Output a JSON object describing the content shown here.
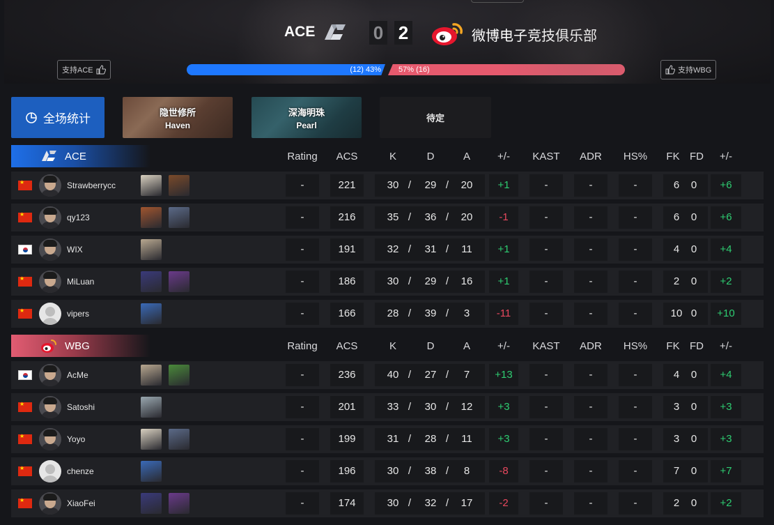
{
  "match": {
    "team_a": {
      "name": "ACE",
      "score": "0",
      "support_label": "支持ACE",
      "vote_text": "(12) 43%",
      "vote_share": 0.43,
      "color": "#1e78ff"
    },
    "team_b": {
      "name": "微博电子竞技俱乐部",
      "short": "WBG",
      "score": "2",
      "support_label": "支持WBG",
      "vote_text": "57% (16)",
      "vote_share": 0.57,
      "color": "#e65a6e"
    }
  },
  "tabs": {
    "overall": "全场统计",
    "maps": [
      {
        "cn": "隐世修所",
        "en": "Haven"
      },
      {
        "cn": "深海明珠",
        "en": "Pearl"
      }
    ],
    "pending": "待定"
  },
  "columns": [
    "Rating",
    "ACS",
    "K",
    "D",
    "A",
    "+/-",
    "KAST",
    "ADR",
    "HS%",
    "FK",
    "FD",
    "+/-"
  ],
  "teams": [
    {
      "tag": "ACE",
      "players": [
        {
          "name": "Strawberrycc",
          "flag": "cn",
          "avatar": "photo",
          "agents": [
            "#d8d0c0",
            "#7a4a2a"
          ],
          "rating": "-",
          "acs": "221",
          "k": "30",
          "d": "29",
          "a": "20",
          "pm": "+1",
          "kast": "-",
          "adr": "-",
          "hs": "-",
          "fk": "6",
          "fd": "0",
          "pm2": "+6"
        },
        {
          "name": "qy123",
          "flag": "cn",
          "avatar": "photo",
          "agents": [
            "#a0552f",
            "#5b6a88"
          ],
          "rating": "-",
          "acs": "216",
          "k": "35",
          "d": "36",
          "a": "20",
          "pm": "-1",
          "kast": "-",
          "adr": "-",
          "hs": "-",
          "fk": "6",
          "fd": "0",
          "pm2": "+6"
        },
        {
          "name": "WIX",
          "flag": "kr",
          "avatar": "photo",
          "agents": [
            "#b8a890"
          ],
          "rating": "-",
          "acs": "191",
          "k": "32",
          "d": "31",
          "a": "11",
          "pm": "+1",
          "kast": "-",
          "adr": "-",
          "hs": "-",
          "fk": "4",
          "fd": "0",
          "pm2": "+4"
        },
        {
          "name": "MiLuan",
          "flag": "cn",
          "avatar": "photo",
          "agents": [
            "#3a3a7a",
            "#6a3a8a"
          ],
          "rating": "-",
          "acs": "186",
          "k": "30",
          "d": "29",
          "a": "16",
          "pm": "+1",
          "kast": "-",
          "adr": "-",
          "hs": "-",
          "fk": "2",
          "fd": "0",
          "pm2": "+2"
        },
        {
          "name": "vipers",
          "flag": "cn",
          "avatar": "blank",
          "agents": [
            "#3a6ab8"
          ],
          "rating": "-",
          "acs": "166",
          "k": "28",
          "d": "39",
          "a": "3",
          "pm": "-11",
          "kast": "-",
          "adr": "-",
          "hs": "-",
          "fk": "10",
          "fd": "0",
          "pm2": "+10"
        }
      ]
    },
    {
      "tag": "WBG",
      "players": [
        {
          "name": "AcMe",
          "flag": "kr",
          "avatar": "photo",
          "agents": [
            "#b8a890",
            "#4a8a3a"
          ],
          "rating": "-",
          "acs": "236",
          "k": "40",
          "d": "27",
          "a": "7",
          "pm": "+13",
          "kast": "-",
          "adr": "-",
          "hs": "-",
          "fk": "4",
          "fd": "0",
          "pm2": "+4"
        },
        {
          "name": "Satoshi",
          "flag": "cn",
          "avatar": "photo",
          "agents": [
            "#9aa8b0"
          ],
          "rating": "-",
          "acs": "201",
          "k": "33",
          "d": "30",
          "a": "12",
          "pm": "+3",
          "kast": "-",
          "adr": "-",
          "hs": "-",
          "fk": "3",
          "fd": "0",
          "pm2": "+3"
        },
        {
          "name": "Yoyo",
          "flag": "cn",
          "avatar": "photo",
          "agents": [
            "#d8d0c0",
            "#5b6a88"
          ],
          "rating": "-",
          "acs": "199",
          "k": "31",
          "d": "28",
          "a": "11",
          "pm": "+3",
          "kast": "-",
          "adr": "-",
          "hs": "-",
          "fk": "3",
          "fd": "0",
          "pm2": "+3"
        },
        {
          "name": "chenze",
          "flag": "cn",
          "avatar": "blank",
          "agents": [
            "#3a6ab8"
          ],
          "rating": "-",
          "acs": "196",
          "k": "30",
          "d": "38",
          "a": "8",
          "pm": "-8",
          "kast": "-",
          "adr": "-",
          "hs": "-",
          "fk": "7",
          "fd": "0",
          "pm2": "+7"
        },
        {
          "name": "XiaoFei",
          "flag": "cn",
          "avatar": "photo",
          "agents": [
            "#3a3a7a",
            "#6a3a8a"
          ],
          "rating": "-",
          "acs": "174",
          "k": "30",
          "d": "32",
          "a": "17",
          "pm": "-2",
          "kast": "-",
          "adr": "-",
          "hs": "-",
          "fk": "2",
          "fd": "0",
          "pm2": "+2"
        }
      ]
    }
  ],
  "colors": {
    "accent_blue": "#1d5fbf",
    "wbg_red": "#e25c72",
    "positive": "#2ecc71",
    "negative": "#e8485e"
  },
  "icons": {
    "team_a_logo": "ace-logo-icon",
    "team_b_logo": "weibo-logo-icon",
    "support": "thumbs-up-icon",
    "overall": "pie-chart-icon"
  }
}
